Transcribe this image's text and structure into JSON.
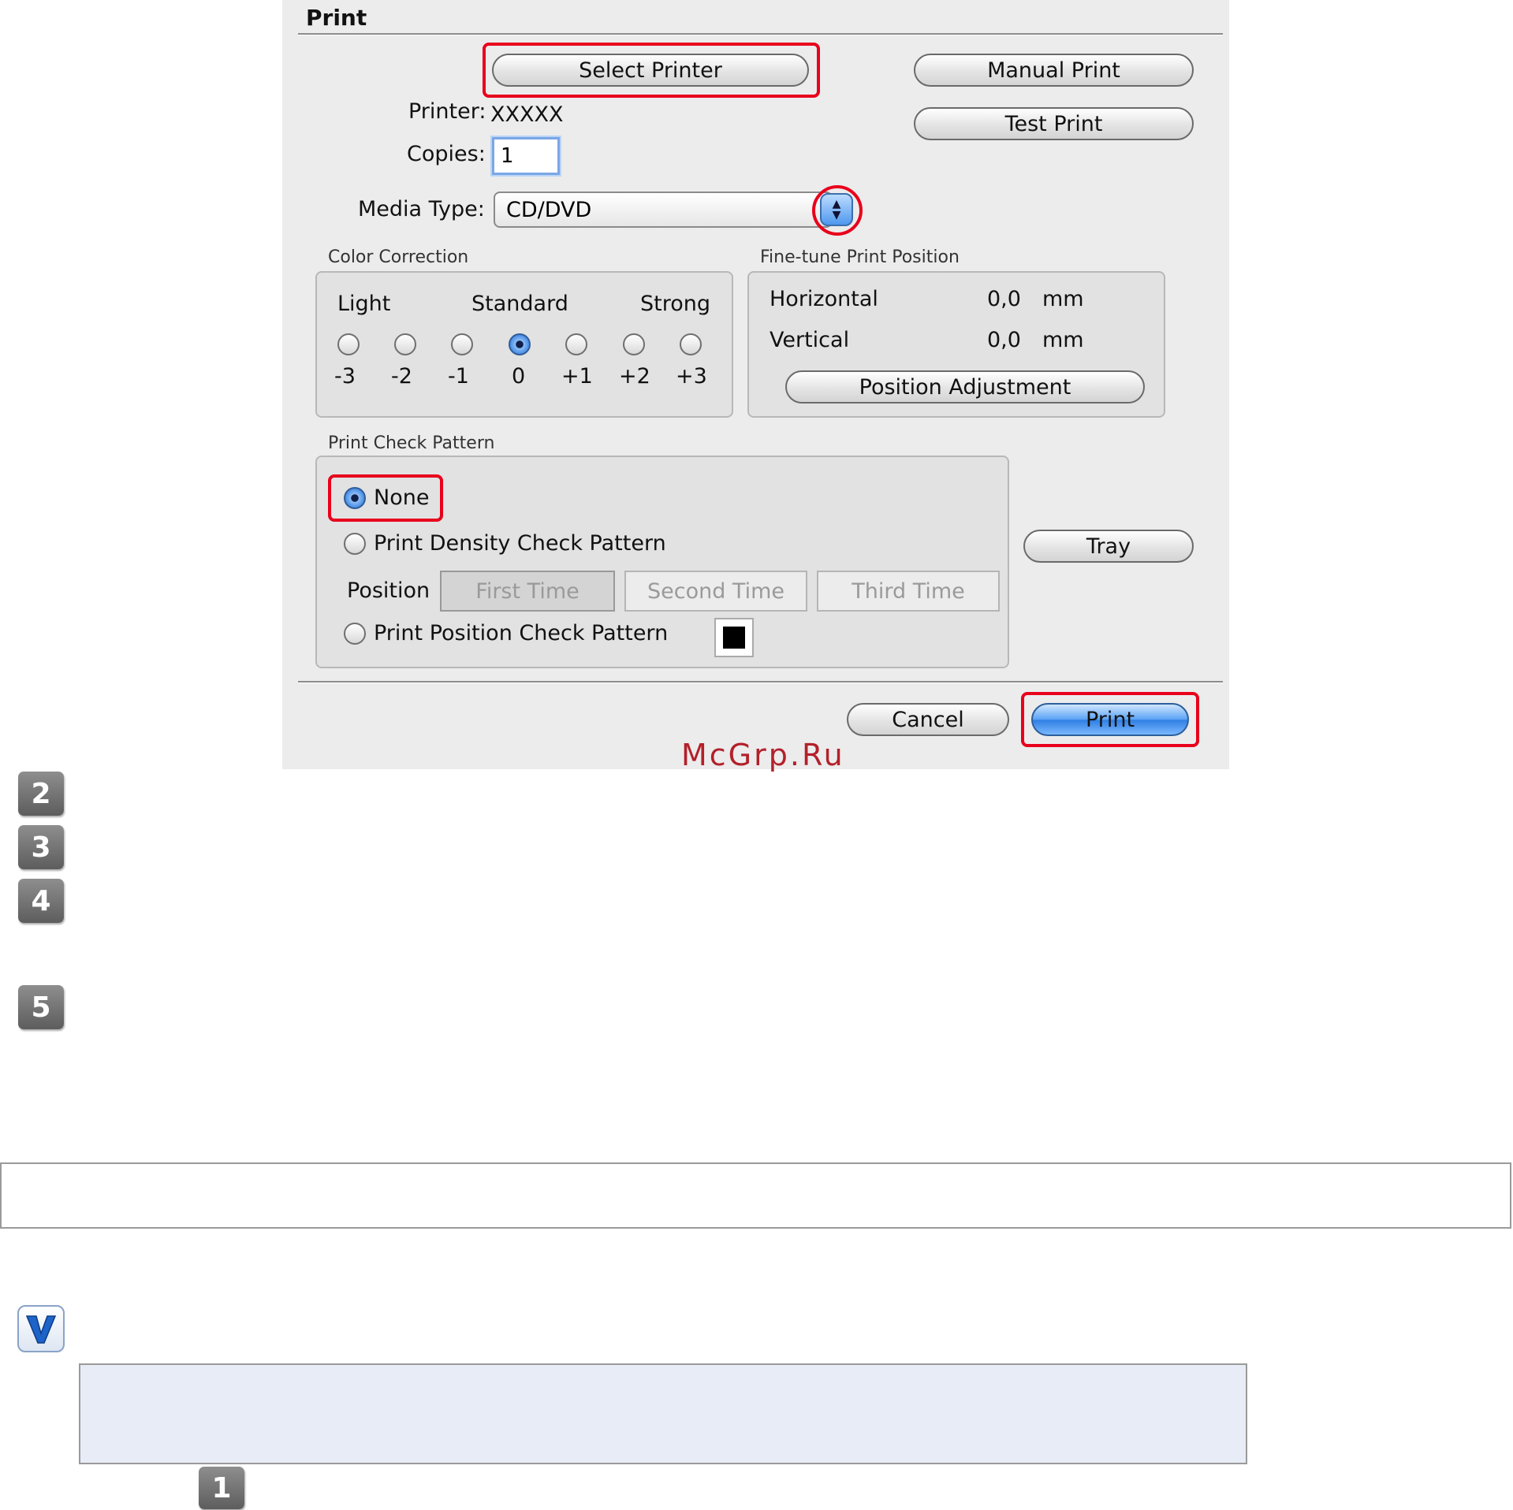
{
  "dialog": {
    "title": "Print",
    "buttons": {
      "select_printer": "Select Printer",
      "manual_print": "Manual Print",
      "test_print": "Test Print",
      "position_adjustment": "Position Adjustment",
      "tray": "Tray",
      "cancel": "Cancel",
      "print": "Print"
    },
    "printer": {
      "label": "Printer:",
      "value": "XXXXX"
    },
    "copies": {
      "label": "Copies:",
      "value": "1"
    },
    "media_type": {
      "label": "Media Type:",
      "value": "CD/DVD"
    },
    "color_correction": {
      "title": "Color Correction",
      "scale_labels": [
        "Light",
        "Standard",
        "Strong"
      ],
      "values": [
        "-3",
        "-2",
        "-1",
        "0",
        "+1",
        "+2",
        "+3"
      ],
      "selected": "0"
    },
    "fine_tune": {
      "title": "Fine-tune Print Position",
      "horizontal": {
        "label": "Horizontal",
        "value": "0,0",
        "unit": "mm"
      },
      "vertical": {
        "label": "Vertical",
        "value": "0,0",
        "unit": "mm"
      }
    },
    "check_pattern": {
      "title": "Print Check Pattern",
      "none": "None",
      "density": "Print Density Check Pattern",
      "position_label": "Position",
      "positions": [
        "First Time",
        "Second Time",
        "Third Time"
      ],
      "position_pattern": "Print Position Check Pattern",
      "selected": "None"
    }
  },
  "watermark": "McGrp.Ru",
  "steps": [
    "2",
    "3",
    "4",
    "5",
    "1"
  ],
  "highlight_color": "#e8001c"
}
